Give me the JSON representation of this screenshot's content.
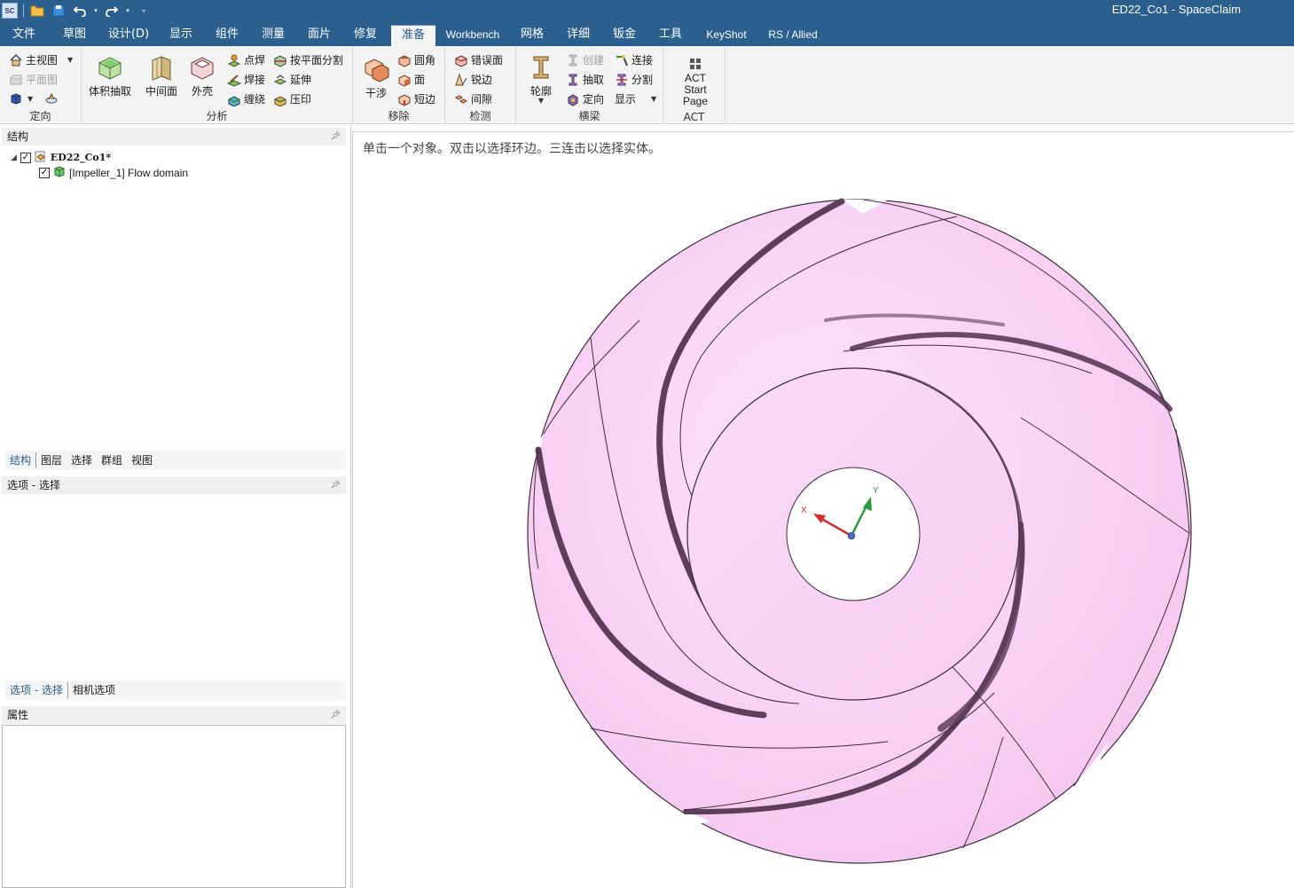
{
  "window": {
    "title": "ED22_Co1 - SpaceClaim",
    "logo": "SC"
  },
  "quick_access": [
    {
      "icon": "open-folder-icon"
    },
    {
      "icon": "save-icon"
    },
    {
      "icon": "undo-icon"
    },
    {
      "icon": "redo-icon"
    },
    {
      "icon": "customize-icon"
    }
  ],
  "menu": {
    "tabs": [
      "文件",
      "草图",
      "设计(D)",
      "显示",
      "组件",
      "测量",
      "面片",
      "修复",
      "准备",
      "Workbench",
      "网格",
      "详细",
      "钣金",
      "工具",
      "KeyShot",
      "RS / Allied"
    ],
    "active": "准备"
  },
  "ribbon": {
    "orient": {
      "label": "定向",
      "home_view": "主视图",
      "plan_view": "平面图"
    },
    "analysis": {
      "label": "分析",
      "volume_extract": "体积抽取",
      "midsurface": "中间面",
      "shell": "外壳",
      "spot_weld": "点焊",
      "weld": "焊接",
      "wrap": "缠绕",
      "split_by_plane": "按平面分割",
      "extend": "延伸",
      "imprint": "压印"
    },
    "remove": {
      "label": "移除",
      "interference": "干涉",
      "round": "圆角",
      "face": "面",
      "short_edge": "短边"
    },
    "detect": {
      "label": "检测",
      "misaligned_face": "错误面",
      "sharp_edge": "锐边",
      "gap": "间隙"
    },
    "beam": {
      "label": "横梁",
      "profile": "轮廓",
      "create": "创建",
      "extract": "抽取",
      "orient": "定向",
      "connect": "连接",
      "split": "分割",
      "display": "显示"
    },
    "act": {
      "label": "ACT",
      "start_page": "ACT Start Page"
    }
  },
  "structure_panel": {
    "title": "结构",
    "root": "ED22_Co1*",
    "child": "[Impeller_1] Flow domain",
    "tabs": [
      "结构",
      "图层",
      "选择",
      "群组",
      "视图"
    ]
  },
  "options_panel": {
    "title": "选项 - 选择",
    "tabs": [
      "选项 - 选择",
      "相机选项"
    ]
  },
  "properties_panel": {
    "title": "属性"
  },
  "viewport": {
    "hint": "单击一个对象。双击以选择环边。三连击以选择实体。",
    "triad": {
      "x_label": "X",
      "y_label": "Y"
    },
    "model_color": "#f9d2f5",
    "edge_color": "#3d2a3a"
  }
}
